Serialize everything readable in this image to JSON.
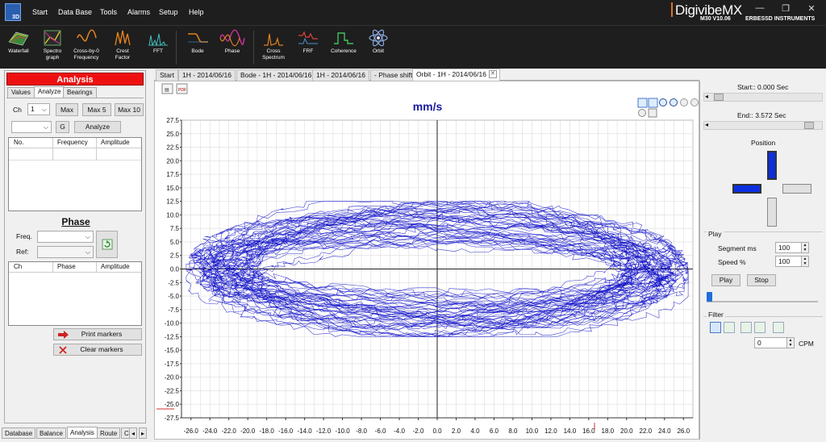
{
  "app": {
    "logo_text": "3D",
    "brand": "DigivibeMX",
    "version": "M30 V10.06",
    "vendor": "ERBESSD INSTRUMENTS",
    "menu": [
      "Start",
      "Data Base",
      "Tools",
      "Alarms",
      "Setup",
      "Help"
    ],
    "window_controls": [
      "—",
      "❐",
      "✕"
    ]
  },
  "toolbar": [
    {
      "label1": "Waterfall",
      "label2": "",
      "icon": "waterfall-icon"
    },
    {
      "label1": "Spectro",
      "label2": "graph",
      "icon": "spectrograph-icon"
    },
    {
      "label1": "Cross-by-0",
      "label2": "Frequency",
      "icon": "cross-by-zero-icon"
    },
    {
      "label1": "Crest",
      "label2": "Factor",
      "icon": "crest-factor-icon"
    },
    {
      "label1": "FFT",
      "label2": "",
      "icon": "fft-icon"
    },
    {
      "label1": "Bode",
      "label2": "",
      "icon": "bode-icon"
    },
    {
      "label1": "Phase",
      "label2": "",
      "icon": "phase-icon"
    },
    {
      "label1": "Cross",
      "label2": "Spectrum",
      "icon": "cross-spectrum-icon"
    },
    {
      "label1": "FRF",
      "label2": "",
      "icon": "frf-icon"
    },
    {
      "label1": "Coherence",
      "label2": "",
      "icon": "coherence-icon"
    },
    {
      "label1": "Orbit",
      "label2": "",
      "icon": "orbit-icon"
    }
  ],
  "left_panel": {
    "header": "Analysis",
    "tabs": [
      "Values",
      "Analyze",
      "Bearings"
    ],
    "active_tab": "Analyze",
    "ch_label": "Ch",
    "ch_value": "1",
    "max_buttons": [
      "Max",
      "Max 5",
      "Max 10"
    ],
    "g_button": "G",
    "analyze_button": "Analyze",
    "peaks_columns": [
      "No.",
      "Frequency",
      "Amplitude"
    ],
    "phase_title": "Phase",
    "freq_label": "Freq.",
    "ref_label": "Ref:",
    "phase_columns": [
      "Ch",
      "Phase",
      "Amplitude"
    ],
    "print_markers": "Print markers",
    "clear_markers": "Clear markers"
  },
  "bottom_tabs": [
    "Database",
    "Balance",
    "Analysis",
    "Route",
    "C"
  ],
  "doc_tabs": [
    "Start",
    "1H - 2014/06/16",
    "Bode - 1H - 2014/06/16",
    "1H - 2014/06/16",
    "- Phase shift",
    "Orbit - 1H - 2014/06/16"
  ],
  "active_doc_tab": 5,
  "right_panel": {
    "start_label": "Start:: 0.000 Sec",
    "end_label": "End:: 3.572 Sec",
    "position_label": "Position",
    "play_group": "Play",
    "segment_label": "Segment ms",
    "segment_value": "100",
    "speed_label": "Speed %",
    "speed_value": "100",
    "play_button": "Play",
    "stop_button": "Stop",
    "filter_group": "Filter",
    "cpm_value": "0",
    "cpm_label": "CPM"
  },
  "colors": {
    "trace": "#1010c8",
    "title": "#1a1aa0",
    "header_red": "#ee1010",
    "position_blue": "#0b2fe0"
  },
  "chart_data": {
    "type": "scatter",
    "title": "mm/s",
    "xlim": [
      -27,
      27
    ],
    "ylim": [
      -27.5,
      27.5
    ],
    "x_ticks": [
      -26,
      -24,
      -22,
      -20,
      -18,
      -16,
      -14,
      -12,
      -10,
      -8,
      -6,
      -4,
      -2,
      0,
      2,
      4,
      6,
      8,
      10,
      12,
      14,
      16,
      18,
      20,
      22,
      24,
      26
    ],
    "y_ticks": [
      27.5,
      25,
      22.5,
      20,
      17.5,
      15,
      12.5,
      10,
      7.5,
      5,
      2.5,
      0,
      -2.5,
      -5,
      -7.5,
      -10,
      -12.5,
      -15,
      -17.5,
      -20,
      -22.5,
      -25,
      -27.5
    ],
    "x_tick_labels": [
      "-26.0",
      "-24.0",
      "-22.0",
      "-20.0",
      "-18.0",
      "-16.0",
      "-14.0",
      "-12.0",
      "-10.0",
      "-8.0",
      "-6.0",
      "-4.0",
      "-2.0",
      "0.0",
      "2.0",
      "4.0",
      "6.0",
      "8.0",
      "10.0",
      "12.0",
      "14.0",
      "16.0",
      "18.0",
      "20.0",
      "22.0",
      "24.0",
      "26.0"
    ],
    "y_tick_labels": [
      "27.5",
      "25.0",
      "22.5",
      "20.0",
      "17.5",
      "15.0",
      "12.5",
      "10.0",
      "7.5",
      "5.0",
      "2.5",
      "0.0",
      "-2.5",
      "-5.0",
      "-7.5",
      "-10.0",
      "-12.5",
      "-15.0",
      "-17.5",
      "-20.0",
      "-22.5",
      "-25.0",
      "-27.5"
    ],
    "orbit_x_range": [
      -26.5,
      26.5
    ],
    "orbit_y_range": [
      -12.5,
      12.5
    ],
    "grid": true,
    "series": [
      {
        "values": []
      }
    ]
  }
}
